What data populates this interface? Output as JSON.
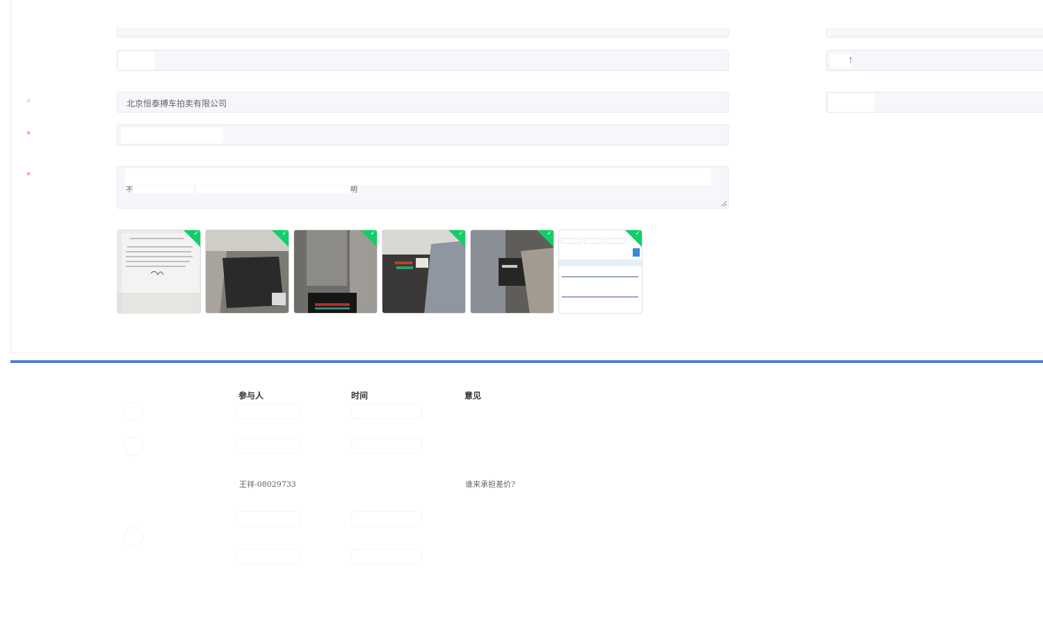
{
  "form": {
    "company_value": "北京恒泰搏车拍卖有限公司",
    "remark_fragment_start": "不",
    "remark_fragment_end": "明",
    "right_field_char": "!",
    "required_mark": "*"
  },
  "photos": [
    {
      "name": "document-photo",
      "checked": true
    },
    {
      "name": "floor-mat-photo",
      "checked": true
    },
    {
      "name": "rear-seat-photo",
      "checked": true
    },
    {
      "name": "seat-floor-photo",
      "checked": true
    },
    {
      "name": "console-photo",
      "checked": true
    },
    {
      "name": "table-screenshot-photo",
      "checked": true
    }
  ],
  "history": {
    "columns": [
      "参与人",
      "时间",
      "意见"
    ],
    "participant": "王祥-08029733",
    "opinion": "谁来承担差价?"
  },
  "colors": {
    "accent": "#4a7fd4",
    "check": "#13ce66",
    "required": "#f56c6c",
    "field_bg": "#f5f7fa"
  }
}
